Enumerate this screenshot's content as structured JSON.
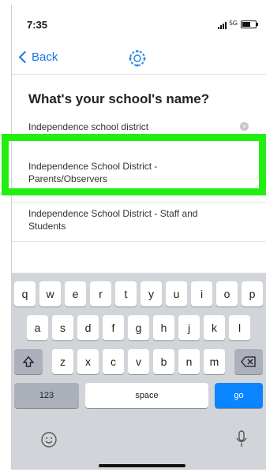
{
  "status_bar": {
    "time": "7:35",
    "network": "5G"
  },
  "nav": {
    "back_label": "Back"
  },
  "title": "What's your school's name?",
  "search": {
    "value": "Independence school district"
  },
  "results": [
    "Independence School District - Parents/Observers",
    "Independence School District - Staff and Students"
  ],
  "keyboard": {
    "row1": [
      "q",
      "w",
      "e",
      "r",
      "t",
      "y",
      "u",
      "i",
      "o",
      "p"
    ],
    "row2": [
      "a",
      "s",
      "d",
      "f",
      "g",
      "h",
      "j",
      "k",
      "l"
    ],
    "row3": [
      "z",
      "x",
      "c",
      "v",
      "b",
      "n",
      "m"
    ],
    "numbers_label": "123",
    "space_label": "space",
    "go_label": "go"
  },
  "colors": {
    "accent": "#1a73e8",
    "highlight": "#22ee12",
    "go_key": "#0a84ff",
    "keyboard_bg": "#d1d4d9"
  }
}
